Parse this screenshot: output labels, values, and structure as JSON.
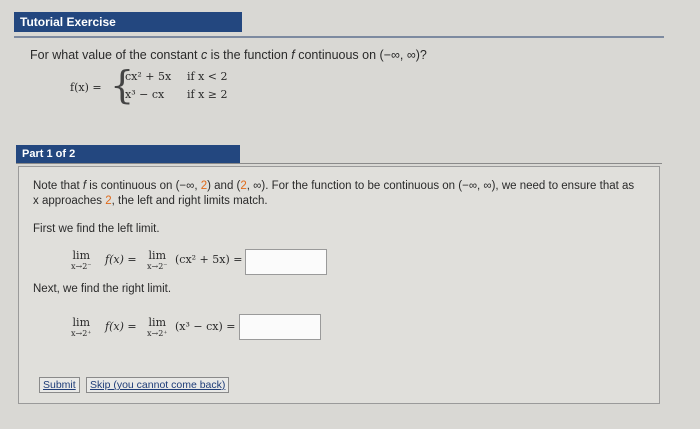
{
  "header": {
    "title": "Tutorial Exercise"
  },
  "question": {
    "prefix": "For what value of the constant ",
    "var_c": "c",
    "middle": " is the function ",
    "var_f": "f",
    "suffix": " continuous on (−∞, ∞)?"
  },
  "piecewise": {
    "label": "f(x) =",
    "brace": "{",
    "case1_expr": "cx² + 5x",
    "case1_cond": "if x < 2",
    "case2_expr": "x³ − cx",
    "case2_cond": "if x ≥ 2"
  },
  "part": {
    "label": "Part 1 of 2"
  },
  "note": {
    "t1": "Note that ",
    "f": "f",
    "t2": " is continuous on (−∞, ",
    "n1": "2",
    "t3": ") and (",
    "n2": "2",
    "t4": ", ∞). For the function to be continuous on (−∞, ∞), we need to ensure that as x approaches ",
    "n3": "2",
    "t5": ", the left and right limits match."
  },
  "left": {
    "title": "First we find the left limit.",
    "lim1": "lim",
    "sub1": "x→2⁻",
    "fx": "f(x)  =",
    "lim2": "lim",
    "sub2": "x→2⁻",
    "expr": "(cx² + 5x)  ="
  },
  "right": {
    "title": "Next, we find the right limit.",
    "lim1": "lim",
    "sub1": "x→2⁺",
    "fx": "f(x)  =",
    "lim2": "lim",
    "sub2": "x→2⁺",
    "expr": "(x³ − cx)  ="
  },
  "buttons": {
    "submit": "Submit",
    "skip": "Skip (you cannot come back)"
  }
}
